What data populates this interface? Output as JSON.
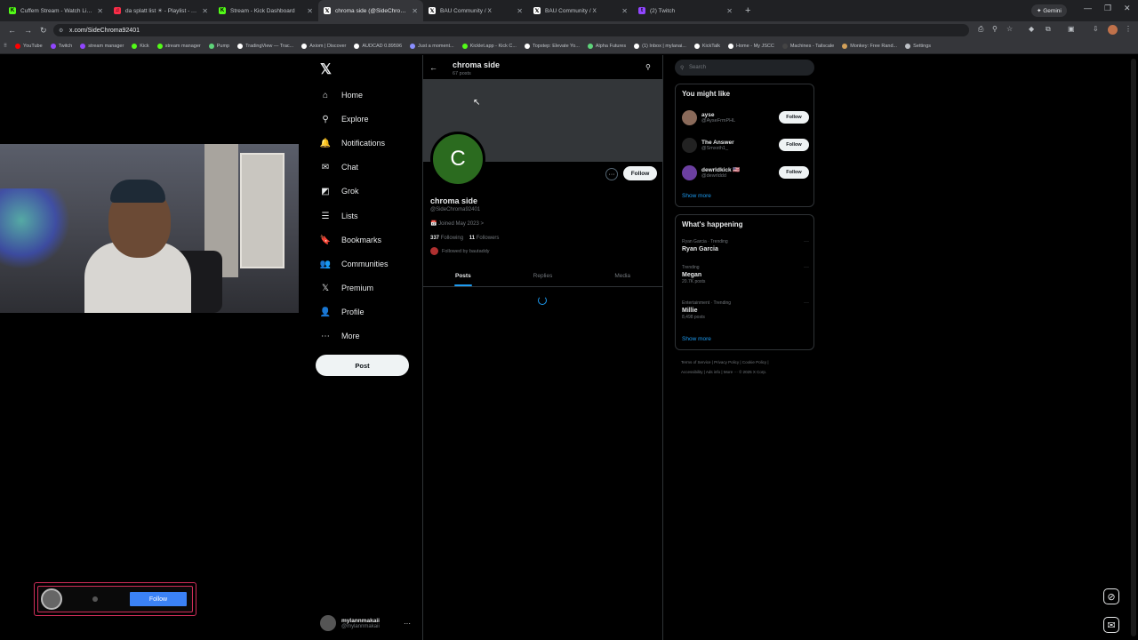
{
  "browser": {
    "tabs": [
      {
        "title": "Cuffem Stream - Watch Live on",
        "color": "#53fc18",
        "glyph": "K",
        "active": false
      },
      {
        "title": "da splatt list ☀ - Playlist - App",
        "color": "#fa2d48",
        "glyph": "♫",
        "active": false
      },
      {
        "title": "Stream - Kick Dashboard",
        "color": "#53fc18",
        "glyph": "K",
        "active": false
      },
      {
        "title": "chroma side (@SideChroma92",
        "color": "#ffffff",
        "glyph": "𝕏",
        "active": true
      },
      {
        "title": "BAU Community / X",
        "color": "#ffffff",
        "glyph": "𝕏",
        "active": false
      },
      {
        "title": "BAU Community / X",
        "color": "#ffffff",
        "glyph": "𝕏",
        "active": false
      },
      {
        "title": "(2) Twitch",
        "color": "#9146ff",
        "glyph": "t",
        "active": false
      }
    ],
    "new_tab": "+",
    "gemini": "✦ Gemini",
    "url": "x.com/SideChroma92401",
    "bookmarks": [
      {
        "label": "YouTube",
        "color": "#ff0000"
      },
      {
        "label": "Twitch",
        "color": "#9146ff"
      },
      {
        "label": "stream manager",
        "color": "#9146ff"
      },
      {
        "label": "Kick",
        "color": "#53fc18"
      },
      {
        "label": "stream manager",
        "color": "#53fc18"
      },
      {
        "label": "Pump",
        "color": "#5ed47a"
      },
      {
        "label": "TradingView — Trac...",
        "color": "#ffffff"
      },
      {
        "label": "Axiom | Discover",
        "color": "#ffffff"
      },
      {
        "label": "AUDCAD 0.89596",
        "color": "#ffffff"
      },
      {
        "label": "Just a moment...",
        "color": "#8a8fff"
      },
      {
        "label": "Kicklet.app - Kick C...",
        "color": "#53fc18"
      },
      {
        "label": "Topstep: Elevate Yo...",
        "color": "#ffffff"
      },
      {
        "label": "Alpha Futures",
        "color": "#5ed47a"
      },
      {
        "label": "(1) Inbox | mylanai...",
        "color": "#ffffff"
      },
      {
        "label": "KickTalk",
        "color": "#ffffff"
      },
      {
        "label": "Home - My JSCC",
        "color": "#ffffff"
      },
      {
        "label": "Machines - Tailscale",
        "color": "#444444"
      },
      {
        "label": "Monkey: Free Rand...",
        "color": "#d2a05a"
      },
      {
        "label": "Settings",
        "color": "#bdc1c6"
      }
    ]
  },
  "nav": {
    "logo": "𝕏",
    "items": [
      {
        "label": "Home",
        "icon": "⌂"
      },
      {
        "label": "Explore",
        "icon": "⚲"
      },
      {
        "label": "Notifications",
        "icon": "🔔"
      },
      {
        "label": "Chat",
        "icon": "✉"
      },
      {
        "label": "Grok",
        "icon": "◩"
      },
      {
        "label": "Lists",
        "icon": "☰"
      },
      {
        "label": "Bookmarks",
        "icon": "🔖"
      },
      {
        "label": "Communities",
        "icon": "👥"
      },
      {
        "label": "Premium",
        "icon": "𝕏"
      },
      {
        "label": "Profile",
        "icon": "👤"
      },
      {
        "label": "More",
        "icon": "⋯"
      }
    ],
    "post_label": "Post",
    "account": {
      "name": "mylannmakaii",
      "handle": "@mylannmakaii",
      "more": "···"
    }
  },
  "profile": {
    "header_name": "chroma side",
    "header_posts": "67 posts",
    "avatar_letter": "C",
    "name": "chroma side",
    "handle": "@SideChroma92401",
    "joined": "📅 Joined May 2023 >",
    "following_count": "337",
    "following_label": "Following",
    "followers_count": "11",
    "followers_label": "Followers",
    "followed_by": "Followed by bautaddy",
    "follow_label": "Follow",
    "more_label": "···",
    "tabs": [
      "Posts",
      "Replies",
      "Media"
    ]
  },
  "right": {
    "search_placeholder": "Search",
    "might_like_title": "You might like",
    "suggestions": [
      {
        "name": "ayse",
        "handle": "@AyseFrmPHL",
        "color": "#8a6a5a",
        "follow": "Follow"
      },
      {
        "name": "The Answer",
        "handle": "@Smxxth1_",
        "color": "#222222",
        "follow": "Follow"
      },
      {
        "name": "dewrldkick 🇺🇸",
        "handle": "@dewrlddd",
        "color": "#6b3fa0",
        "follow": "Follow"
      }
    ],
    "show_more": "Show more",
    "happening_title": "What's happening",
    "trends": [
      {
        "meta": "Ryan Garcia · Trending",
        "name": "Ryan Garcia",
        "count": ""
      },
      {
        "meta": "Trending",
        "name": "Megan",
        "count": "20.7K posts"
      },
      {
        "meta": "Entertainment · Trending",
        "name": "Millie",
        "count": "8,498 posts"
      }
    ],
    "trend_more": "···",
    "footer_line1": "Terms of Service  |  Privacy Policy  |  Cookie Policy  |",
    "footer_line2": "Accessibility  |  Ads info  |  More ···  © 2025 X Corp."
  },
  "overlay": {
    "follow_label": "Follow"
  }
}
